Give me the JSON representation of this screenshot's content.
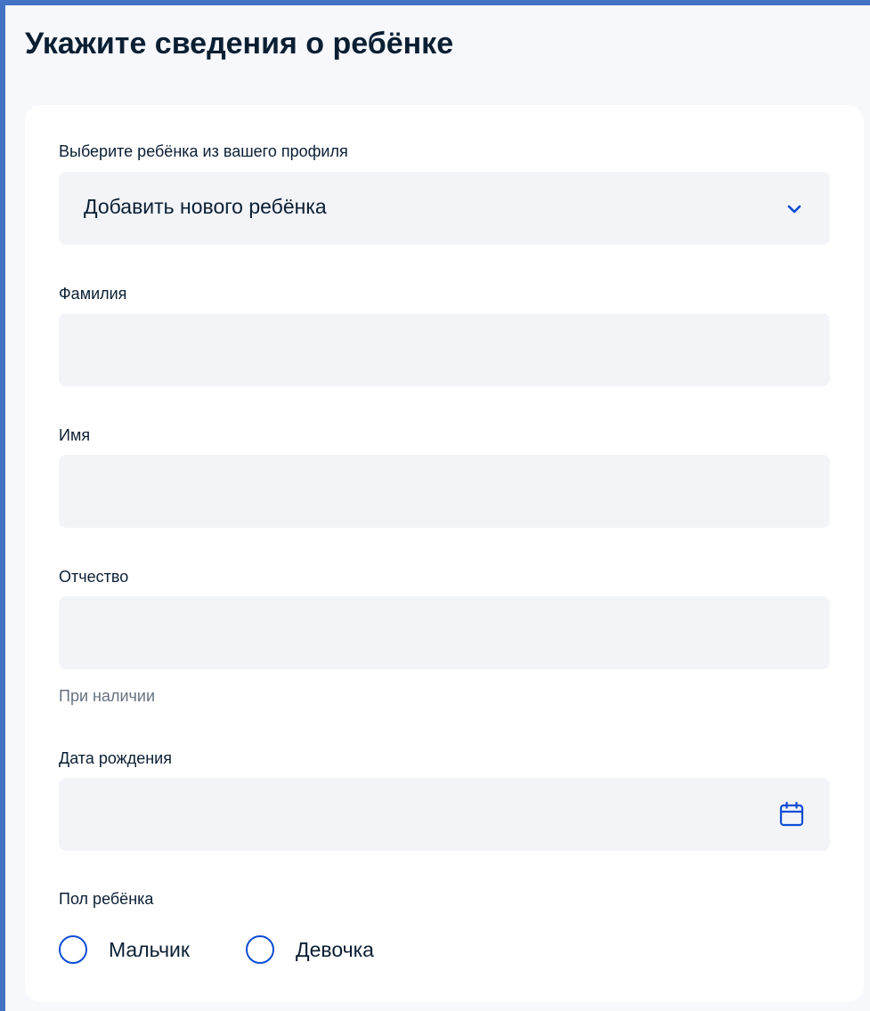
{
  "page": {
    "title": "Укажите сведения о ребёнке"
  },
  "form": {
    "child_select": {
      "label": "Выберите ребёнка из вашего профиля",
      "value": "Добавить нового ребёнка"
    },
    "surname": {
      "label": "Фамилия",
      "value": ""
    },
    "name": {
      "label": "Имя",
      "value": ""
    },
    "patronymic": {
      "label": "Отчество",
      "value": "",
      "hint": "При наличии"
    },
    "birth_date": {
      "label": "Дата рождения",
      "value": ""
    },
    "gender": {
      "label": "Пол ребёнка",
      "options": [
        {
          "label": "Мальчик",
          "selected": false
        },
        {
          "label": "Девочка",
          "selected": false
        }
      ]
    }
  },
  "icons": {
    "select_chevron": "chevron-down-icon",
    "date_picker": "calendar-icon"
  },
  "colors": {
    "accent": "#0d4cd3",
    "field_background": "#f2f4f8",
    "page_background": "#f6f8fc",
    "text": "#0b1f33",
    "hint_text": "#66727f"
  }
}
